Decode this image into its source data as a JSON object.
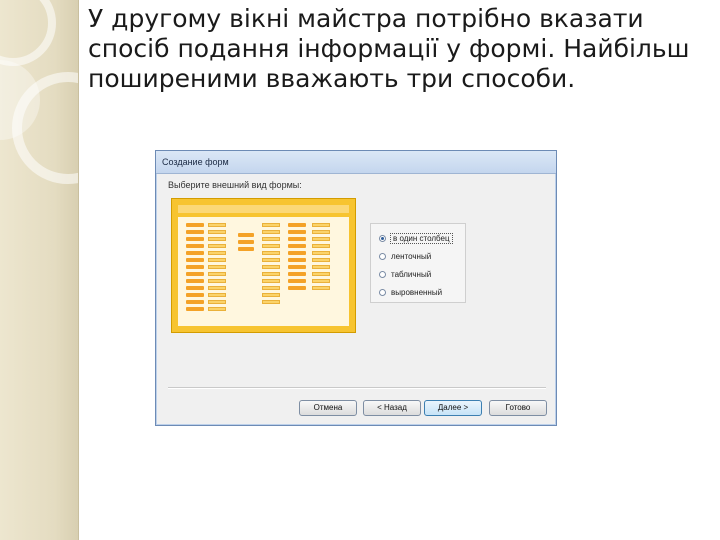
{
  "slide": {
    "text": "У другому вікні майстра потрібно вказати спосіб подання інформації у формі. Найбільш поширеними вважають три способи."
  },
  "dialog": {
    "title": "Создание форм",
    "prompt": "Выберите внешний вид формы:",
    "options": [
      {
        "label": "в один столбец",
        "selected": true
      },
      {
        "label": "ленточный",
        "selected": false
      },
      {
        "label": "табличный",
        "selected": false
      },
      {
        "label": "выровненный",
        "selected": false
      }
    ],
    "buttons": {
      "cancel": "Отмена",
      "back": "< Назад",
      "next": "Далее >",
      "finish": "Готово"
    }
  },
  "colors": {
    "preview_fill": "#f7c430",
    "preview_label": "#f4a227",
    "window_border": "#6d8bb5"
  }
}
